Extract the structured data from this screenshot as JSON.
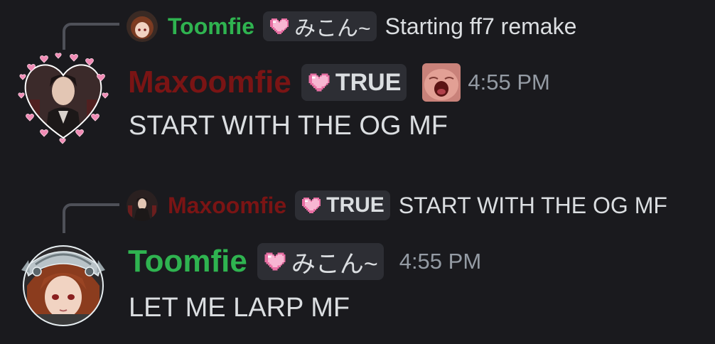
{
  "colors": {
    "background": "#1a1a1e",
    "toomfie_name": "#2fb350",
    "maxoomfie_name": "#7a1414",
    "timestamp": "#949ba4",
    "tag_bg": "#2d2e34",
    "heart_pink": "#f08bb5"
  },
  "messages": [
    {
      "reply": {
        "author": "Toomfie",
        "tag_icon": "pixel-heart-icon",
        "tag": "みこん~",
        "text": "Starting ff7 remake"
      },
      "author": "Maxoomfie",
      "tag_icon": "pixel-heart-icon",
      "tag": "TRUE",
      "emoji": "crying-baby-emoji",
      "timestamp": "4:55 PM",
      "content": "START WITH THE OG MF"
    },
    {
      "reply": {
        "author": "Maxoomfie",
        "tag_icon": "pixel-heart-icon",
        "tag": "TRUE",
        "text": "START WITH THE OG MF"
      },
      "author": "Toomfie",
      "tag_icon": "pixel-heart-icon",
      "tag": "みこん~",
      "timestamp": "4:55 PM",
      "content": "LET ME LARP MF"
    }
  ]
}
